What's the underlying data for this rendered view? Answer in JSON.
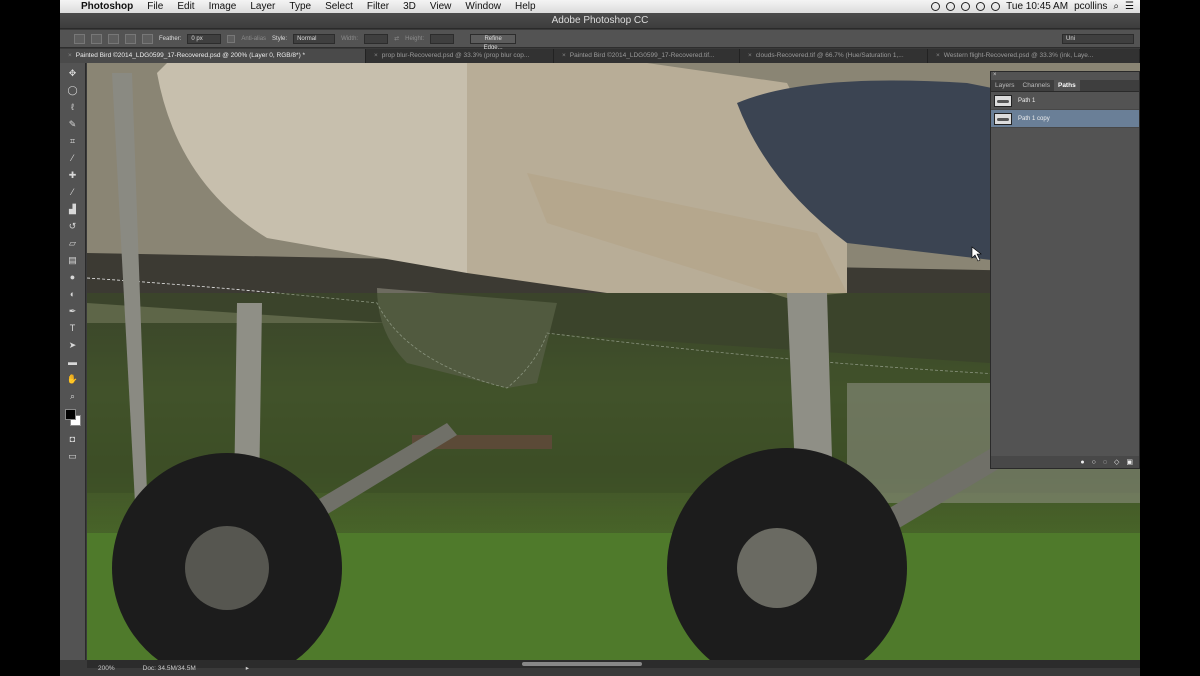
{
  "menubar": {
    "apple": "",
    "app": "Photoshop",
    "items": [
      "File",
      "Edit",
      "Image",
      "Layer",
      "Type",
      "Select",
      "Filter",
      "3D",
      "View",
      "Window",
      "Help"
    ],
    "clock": "Tue 10:45 AM",
    "user": "pcollins"
  },
  "window_title": "Adobe Photoshop CC",
  "options": {
    "feather_label": "Feather:",
    "feather_value": "0 px",
    "antialias_label": "Anti-alias",
    "style_label": "Style:",
    "style_value": "Normal",
    "width_label": "Width:",
    "height_label": "Height:",
    "refine_label": "Refine Edge...",
    "workspace": "Uni"
  },
  "tabs": [
    {
      "label": "Painted Bird ©2014_LDG0599_17-Recovered.psd @ 200% (Layer 0, RGB/8*) *"
    },
    {
      "label": "prop blur-Recovered.psd @ 33.3% (prop blur cop..."
    },
    {
      "label": "Painted Bird ©2014_LDG0599_17-Recovered.tif..."
    },
    {
      "label": "clouds-Recovered.tif @ 66.7% (Hue/Saturation 1,..."
    },
    {
      "label": "Western flight-Recovered.psd @ 33.3% (ink, Laye..."
    }
  ],
  "panel": {
    "tabs": [
      "Layers",
      "Channels",
      "Paths"
    ],
    "rows": [
      "Path 1",
      "Path 1 copy"
    ]
  },
  "status": {
    "zoom": "200%",
    "doc": "Doc: 34.5M/34.5M"
  }
}
